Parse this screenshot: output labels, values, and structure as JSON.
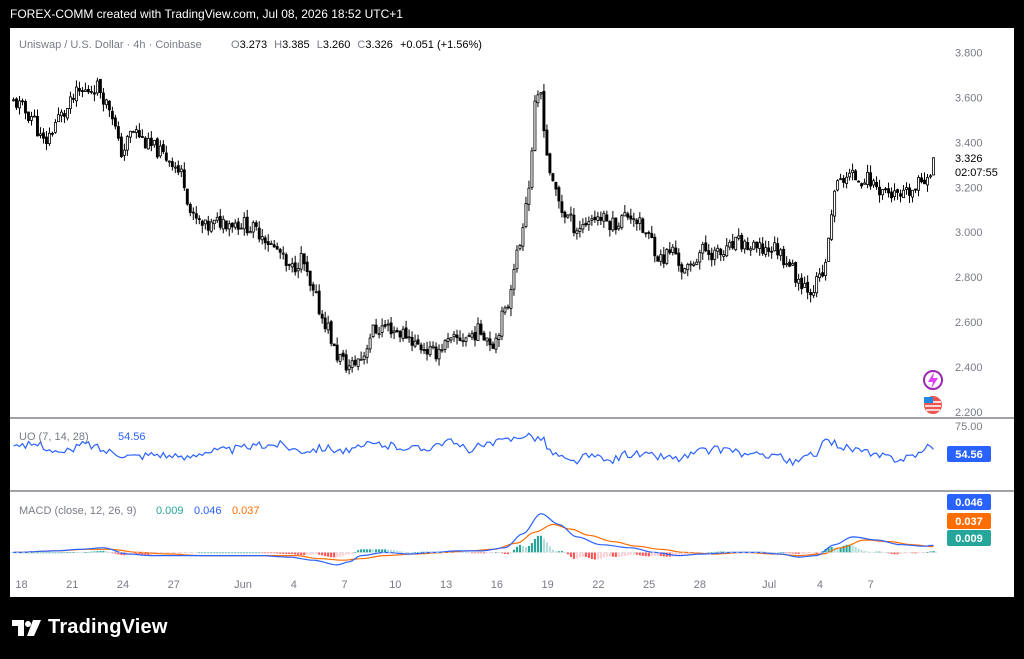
{
  "header": {
    "text": "FOREX-COMM created with TradingView.com, Jul 08, 2026 18:52 UTC+1"
  },
  "footer": {
    "brand": "TradingView",
    "logo_icon": "tradingview-logo-icon"
  },
  "colors": {
    "up": "#089981",
    "down": "#f23645",
    "candle": "#000000",
    "uo": "#2962ff",
    "macd": "#2962ff",
    "signal": "#ff6d00",
    "hist_up_strong": "#26a69a",
    "hist_up_weak": "#b2dfdb",
    "hist_down_strong": "#ff5252",
    "hist_down_weak": "#ffcdd2",
    "text": "#787b86"
  },
  "chart_data": [
    {
      "type": "candlestick",
      "title": "Uniswap / U.S. Dollar · 4h · Coinbase",
      "ohlc": {
        "o_label": "O",
        "o": "3.273",
        "h_label": "H",
        "h": "3.385",
        "l_label": "L",
        "l": "3.260",
        "c_label": "C",
        "c": "3.326",
        "change": "+0.051 (+1.56%)"
      },
      "last_price": "3.326",
      "countdown": "02:07:55",
      "y_ticks": [
        "3.800",
        "3.600",
        "3.400",
        "3.200",
        "3.000",
        "2.800",
        "2.600",
        "2.400",
        "2.200"
      ],
      "ylim": [
        2.19,
        3.83
      ],
      "x_ticks": [
        "18",
        "21",
        "24",
        "27",
        "Jun",
        "4",
        "7",
        "10",
        "13",
        "16",
        "19",
        "22",
        "25",
        "28",
        "Jul",
        "4",
        "7"
      ],
      "anchors": [
        [
          0,
          3.58
        ],
        [
          6,
          3.52
        ],
        [
          10,
          3.4
        ],
        [
          16,
          3.52
        ],
        [
          22,
          3.62
        ],
        [
          28,
          3.65
        ],
        [
          32,
          3.56
        ],
        [
          36,
          3.36
        ],
        [
          40,
          3.45
        ],
        [
          46,
          3.38
        ],
        [
          52,
          3.33
        ],
        [
          56,
          3.26
        ],
        [
          60,
          3.06
        ],
        [
          64,
          3.02
        ],
        [
          70,
          3.05
        ],
        [
          76,
          3.04
        ],
        [
          82,
          3.0
        ],
        [
          88,
          2.92
        ],
        [
          92,
          2.83
        ],
        [
          96,
          2.88
        ],
        [
          100,
          2.72
        ],
        [
          104,
          2.6
        ],
        [
          108,
          2.45
        ],
        [
          112,
          2.4
        ],
        [
          116,
          2.44
        ],
        [
          120,
          2.56
        ],
        [
          124,
          2.58
        ],
        [
          130,
          2.55
        ],
        [
          136,
          2.49
        ],
        [
          140,
          2.46
        ],
        [
          144,
          2.5
        ],
        [
          150,
          2.53
        ],
        [
          156,
          2.56
        ],
        [
          160,
          2.51
        ],
        [
          164,
          2.64
        ],
        [
          168,
          2.9
        ],
        [
          172,
          3.2
        ],
        [
          174,
          3.55
        ],
        [
          176,
          3.62
        ],
        [
          178,
          3.35
        ],
        [
          180,
          3.2
        ],
        [
          184,
          3.08
        ],
        [
          188,
          3.02
        ],
        [
          194,
          3.07
        ],
        [
          200,
          3.04
        ],
        [
          206,
          3.08
        ],
        [
          212,
          2.98
        ],
        [
          216,
          2.88
        ],
        [
          220,
          2.92
        ],
        [
          224,
          2.82
        ],
        [
          230,
          2.92
        ],
        [
          236,
          2.9
        ],
        [
          242,
          2.95
        ],
        [
          248,
          2.92
        ],
        [
          254,
          2.93
        ],
        [
          258,
          2.88
        ],
        [
          262,
          2.79
        ],
        [
          266,
          2.75
        ],
        [
          270,
          2.8
        ],
        [
          272,
          2.95
        ],
        [
          274,
          3.2
        ],
        [
          278,
          3.25
        ],
        [
          284,
          3.24
        ],
        [
          290,
          3.19
        ],
        [
          296,
          3.15
        ],
        [
          300,
          3.18
        ],
        [
          304,
          3.24
        ],
        [
          306,
          3.28
        ],
        [
          307,
          3.33
        ]
      ]
    },
    {
      "type": "line",
      "title": "UO (7, 14, 28)",
      "value": "54.56",
      "y_ticks": [
        "75.00"
      ],
      "ylim": [
        25,
        75
      ],
      "anchors": [
        [
          0,
          56
        ],
        [
          8,
          60
        ],
        [
          16,
          52
        ],
        [
          24,
          60
        ],
        [
          32,
          54
        ],
        [
          40,
          50
        ],
        [
          48,
          52
        ],
        [
          56,
          48
        ],
        [
          64,
          54
        ],
        [
          72,
          55
        ],
        [
          80,
          58
        ],
        [
          88,
          60
        ],
        [
          96,
          55
        ],
        [
          104,
          57
        ],
        [
          112,
          54
        ],
        [
          120,
          60
        ],
        [
          128,
          58
        ],
        [
          136,
          56
        ],
        [
          144,
          62
        ],
        [
          152,
          56
        ],
        [
          160,
          60
        ],
        [
          166,
          64
        ],
        [
          170,
          68
        ],
        [
          176,
          65
        ],
        [
          180,
          52
        ],
        [
          186,
          45
        ],
        [
          192,
          50
        ],
        [
          198,
          46
        ],
        [
          206,
          52
        ],
        [
          214,
          50
        ],
        [
          222,
          48
        ],
        [
          230,
          54
        ],
        [
          238,
          56
        ],
        [
          246,
          50
        ],
        [
          254,
          52
        ],
        [
          260,
          44
        ],
        [
          266,
          50
        ],
        [
          272,
          62
        ],
        [
          280,
          56
        ],
        [
          288,
          50
        ],
        [
          296,
          48
        ],
        [
          302,
          52
        ],
        [
          306,
          57
        ],
        [
          307,
          54.56
        ]
      ]
    },
    {
      "type": "line",
      "title": "MACD (close, 12, 26, 9)",
      "macd_value": "0.009",
      "signal_value": "0.046",
      "hist_value": "0.037",
      "ylim": [
        -0.1,
        0.35
      ],
      "macd_anchors": [
        [
          0,
          0.0
        ],
        [
          14,
          0.01
        ],
        [
          22,
          0.02
        ],
        [
          30,
          0.03
        ],
        [
          38,
          -0.01
        ],
        [
          46,
          -0.02
        ],
        [
          54,
          -0.02
        ],
        [
          62,
          -0.02
        ],
        [
          72,
          -0.02
        ],
        [
          82,
          -0.02
        ],
        [
          92,
          -0.03
        ],
        [
          100,
          -0.05
        ],
        [
          108,
          -0.08
        ],
        [
          112,
          -0.06
        ],
        [
          116,
          -0.02
        ],
        [
          124,
          0.0
        ],
        [
          132,
          -0.01
        ],
        [
          140,
          0.0
        ],
        [
          148,
          0.01
        ],
        [
          156,
          0.01
        ],
        [
          164,
          0.03
        ],
        [
          170,
          0.12
        ],
        [
          176,
          0.25
        ],
        [
          182,
          0.18
        ],
        [
          188,
          0.1
        ],
        [
          196,
          0.05
        ],
        [
          206,
          0.03
        ],
        [
          214,
          0.0
        ],
        [
          222,
          -0.02
        ],
        [
          230,
          -0.01
        ],
        [
          240,
          0.0
        ],
        [
          248,
          0.0
        ],
        [
          256,
          -0.01
        ],
        [
          262,
          -0.03
        ],
        [
          268,
          -0.02
        ],
        [
          274,
          0.05
        ],
        [
          280,
          0.1
        ],
        [
          288,
          0.08
        ],
        [
          296,
          0.05
        ],
        [
          304,
          0.04
        ],
        [
          307,
          0.046
        ]
      ],
      "signal_anchors": [
        [
          0,
          0.0
        ],
        [
          14,
          0.01
        ],
        [
          24,
          0.02
        ],
        [
          32,
          0.02
        ],
        [
          42,
          0.0
        ],
        [
          52,
          -0.01
        ],
        [
          62,
          -0.02
        ],
        [
          72,
          -0.02
        ],
        [
          84,
          -0.02
        ],
        [
          94,
          -0.02
        ],
        [
          102,
          -0.04
        ],
        [
          110,
          -0.05
        ],
        [
          116,
          -0.04
        ],
        [
          124,
          -0.02
        ],
        [
          134,
          -0.01
        ],
        [
          144,
          0.0
        ],
        [
          152,
          0.01
        ],
        [
          160,
          0.02
        ],
        [
          168,
          0.06
        ],
        [
          174,
          0.13
        ],
        [
          180,
          0.18
        ],
        [
          186,
          0.15
        ],
        [
          192,
          0.11
        ],
        [
          200,
          0.07
        ],
        [
          208,
          0.04
        ],
        [
          216,
          0.02
        ],
        [
          224,
          0.0
        ],
        [
          234,
          -0.01
        ],
        [
          244,
          0.0
        ],
        [
          254,
          -0.01
        ],
        [
          262,
          -0.02
        ],
        [
          270,
          -0.01
        ],
        [
          276,
          0.03
        ],
        [
          284,
          0.08
        ],
        [
          292,
          0.07
        ],
        [
          300,
          0.05
        ],
        [
          307,
          0.037
        ]
      ]
    }
  ]
}
